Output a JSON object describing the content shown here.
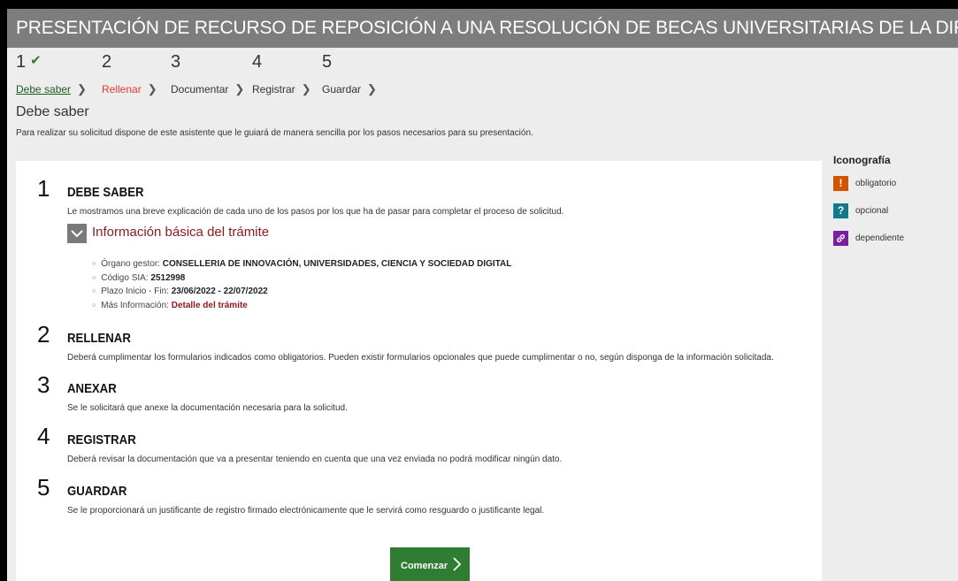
{
  "title": "PRESENTACIÓN DE RECURSO DE REPOSICIÓN A UNA RESOLUCIÓN DE BECAS UNIVERSITARIAS DE LA DIRECCIÓN GENERAL DE UNIVERSIDADES, DE LA CONSE...",
  "steps": [
    {
      "num": "1",
      "label": "Debe saber",
      "state": "done"
    },
    {
      "num": "2",
      "label": "Rellenar",
      "state": "active"
    },
    {
      "num": "3",
      "label": "Documentar",
      "state": "pending"
    },
    {
      "num": "4",
      "label": "Registrar",
      "state": "pending"
    },
    {
      "num": "5",
      "label": "Guardar",
      "state": "pending"
    }
  ],
  "page": {
    "title": "Debe saber",
    "description": "Para realizar su solicitud dispone de este asistente que le guiará de manera sencilla por los pasos necesarios para su presentación."
  },
  "items": [
    {
      "num": "1",
      "title": "DEBE SABER",
      "desc": "Le mostramos una breve explicación de cada uno de los pasos por los que ha de pasar para completar el proceso de solicitud."
    },
    {
      "num": "2",
      "title": "RELLENAR",
      "desc": "Deberá cumplimentar los formularios indicados como obligatorios. Pueden existir formularios opcionales que puede cumplimentar o no, según disponga de la información solicitada."
    },
    {
      "num": "3",
      "title": "ANEXAR",
      "desc": "Se le solicitará que anexe la documentación necesaria para la solicitud."
    },
    {
      "num": "4",
      "title": "REGISTRAR",
      "desc": "Deberá revisar la documentación que va a presentar teniendo en cuenta que una vez enviada no podrá modificar ningún dato."
    },
    {
      "num": "5",
      "title": "GUARDAR",
      "desc": "Se le proporcionará un justificante de registro firmado electrónicamente que le servirá como resguardo o justificante legal."
    }
  ],
  "info": {
    "title": "Información básica del trámite",
    "organo_label": "Órgano gestor: ",
    "organo_value": "CONSELLERIA DE INNOVACIÓN, UNIVERSIDADES, CIENCIA Y SOCIEDAD DIGITAL",
    "sia_label": "Código SIA: ",
    "sia_value": "2512998",
    "plazo_label": "Plazo Inicio - Fin: ",
    "plazo_value": "23/06/2022 - 22/07/2022",
    "mas_label": "Más Información: ",
    "mas_link": "Detalle del trámite"
  },
  "start_button": "Comenzar",
  "iconografia": {
    "title": "Iconografía",
    "items": [
      {
        "symbol": "!",
        "label": "obligatorio",
        "color": "#d35400",
        "icon": "exclamation-icon"
      },
      {
        "symbol": "?",
        "label": "opcional",
        "color": "#117a8b",
        "icon": "question-icon"
      },
      {
        "symbol": "🔗",
        "label": "dependiente",
        "color": "#7b1fa2",
        "icon": "link-icon"
      }
    ]
  },
  "colors": {
    "title_bar": "#7d7d7d",
    "done": "#1b5e20",
    "active": "#e53935",
    "button": "#2e7d32",
    "info_title": "#8b1a1a"
  }
}
